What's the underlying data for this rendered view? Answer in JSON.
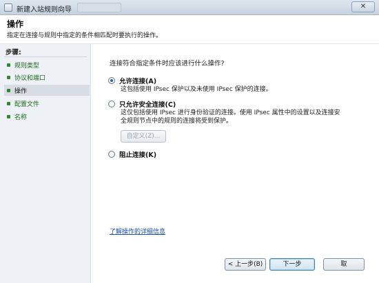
{
  "window": {
    "title": "新建入站规则向导",
    "close_label": "✕"
  },
  "header": {
    "title": "操作",
    "subtitle": "指定在连接与规则中指定的条件相匹配时要执行的操作。"
  },
  "steps": {
    "label": "步骤:",
    "items": [
      {
        "label": "规则类型",
        "state": "done"
      },
      {
        "label": "协议和端口",
        "state": "done"
      },
      {
        "label": "操作",
        "state": "active"
      },
      {
        "label": "配置文件",
        "state": "todo"
      },
      {
        "label": "名称",
        "state": "todo"
      }
    ]
  },
  "main": {
    "question": "连接符合指定条件时应该进行什么操作?",
    "options": [
      {
        "label": "允许连接(A)",
        "checked": true,
        "desc_lines": [
          "这包括使用 IPsec 保护以及未使用 IPsec 保护的连接。"
        ]
      },
      {
        "label": "只允许安全连接(C)",
        "checked": false,
        "desc_lines": [
          "这仅包括使用 IPsec 进行身份验证的连接。使用 IPsec 属性中的设置以及连接安",
          "全规则节点中的规则的连接将受到保护。"
        ]
      },
      {
        "label": "阻止连接(K)",
        "checked": false,
        "desc_lines": []
      }
    ],
    "customize_label": "自定义(Z)...",
    "learn_more": "了解操作的详细信息"
  },
  "buttons": {
    "back": "< 上一步(B)",
    "next": "下一步",
    "cancel": "取"
  }
}
